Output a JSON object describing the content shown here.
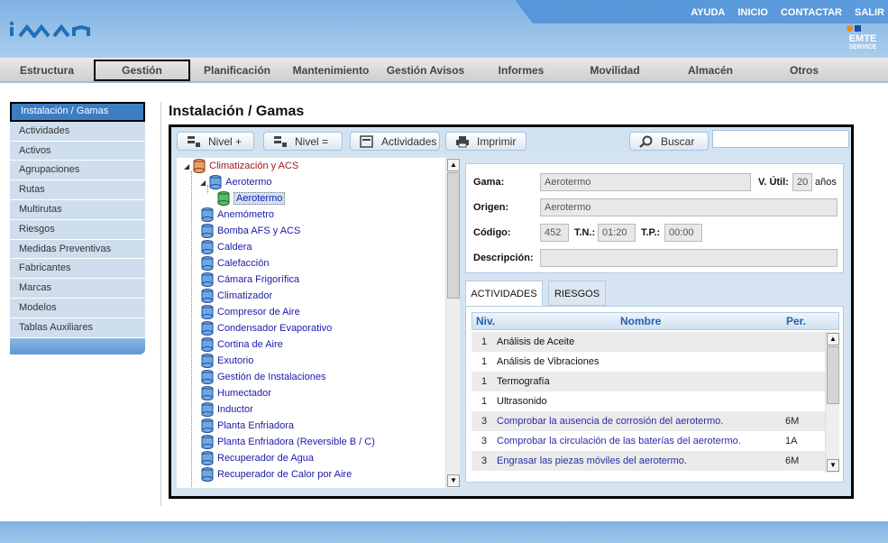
{
  "header": {
    "logo": "iман",
    "links": [
      "AYUDA",
      "INICIO",
      "CONTACTAR",
      "SALIR"
    ],
    "brand": {
      "name": "EMTE",
      "sub": "SERVICE",
      "accent_orange": "#f08a1a",
      "accent_blue": "#1a4fa0"
    }
  },
  "mainnav": [
    "Estructura",
    "Gestión",
    "Planificación",
    "Mantenimiento",
    "Gestión Avisos",
    "Informes",
    "Movilidad",
    "Almacén",
    "Otros"
  ],
  "sidebar": [
    "Instalación / Gamas",
    "Actividades",
    "Activos",
    "Agrupaciones",
    "Rutas",
    "Multirutas",
    "Riesgos",
    "Medidas Preventivas",
    "Fabricantes",
    "Marcas",
    "Modelos",
    "Tablas Auxiliares"
  ],
  "page_title": "Instalación / Gamas",
  "toolbar": {
    "nivel_plus": "Nivel +",
    "nivel_eq": "Nivel =",
    "actividades": "Actividades",
    "imprimir": "Imprimir",
    "buscar": "Buscar",
    "search_value": ""
  },
  "tree": {
    "root": "Climatización y ACS",
    "items": [
      "Aerotermo",
      "Aerotermo",
      "Anemómetro",
      "Bomba AFS y ACS",
      "Caldera",
      "Calefacción",
      "Cámara Frigorífica",
      "Climatizador",
      "Compresor de Aire",
      "Condensador Evaporativo",
      "Cortina de Aire",
      "Exutorio",
      "Gestión de Instalaciones",
      "Humectador",
      "Inductor",
      "Planta Enfriadora",
      "Planta Enfriadora (Reversible B / C)",
      "Recuperador de Agua",
      "Recuperador de Calor por Aire"
    ]
  },
  "form": {
    "gama_label": "Gama:",
    "gama_value": "Aerotermo",
    "vutil_label": "V. Útil:",
    "vutil_value": "20",
    "vutil_unit": "años",
    "origen_label": "Origen:",
    "origen_value": "Aerotermo",
    "codigo_label": "Código:",
    "codigo_value": "452",
    "tn_label": "T.N.:",
    "tn_value": "01:20",
    "tp_label": "T.P.:",
    "tp_value": "00:00",
    "desc_label": "Descripción:",
    "desc_value": ""
  },
  "tabs": [
    "ACTIVIDADES",
    "RIESGOS"
  ],
  "list": {
    "headers": {
      "niv": "Niv.",
      "nombre": "Nombre",
      "per": "Per."
    },
    "rows": [
      {
        "niv": "1",
        "nombre": "Análisis de Aceite",
        "per": ""
      },
      {
        "niv": "1",
        "nombre": "Análisis de Vibraciones",
        "per": ""
      },
      {
        "niv": "1",
        "nombre": "Termografía",
        "per": ""
      },
      {
        "niv": "1",
        "nombre": "Ultrasonido",
        "per": ""
      },
      {
        "niv": "3",
        "nombre": "Comprobar la ausencia de corrosión del aerotermo.",
        "per": "6M"
      },
      {
        "niv": "3",
        "nombre": "Comprobar la circulación de las baterías del aerotermo.",
        "per": "1A"
      },
      {
        "niv": "3",
        "nombre": "Engrasar las piezas móviles del aerotermo.",
        "per": "6M"
      }
    ]
  }
}
